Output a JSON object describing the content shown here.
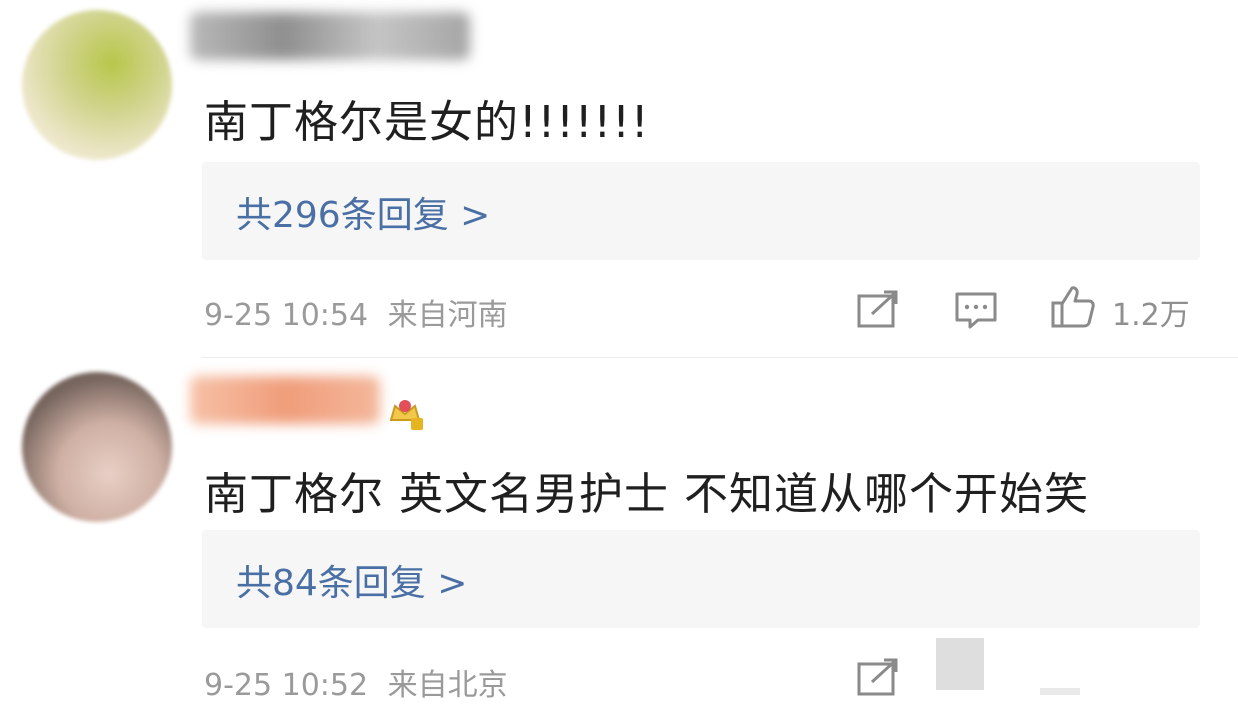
{
  "comments": [
    {
      "text": "南丁格尔是女的!!!!!!!",
      "reply_link": "共296条回复 >",
      "time": "9-25 10:54",
      "location": "来自河南",
      "likes": "1.2万",
      "avatar_colors": [
        "#c9cf7a",
        "#e9e4c6"
      ],
      "username_blur_color": "#9a9a9a"
    },
    {
      "text": "南丁格尔 英文名男护士 不知道从哪个开始笑",
      "reply_link": "共84条回复 >",
      "time": "9-25 10:52",
      "location": "来自北京",
      "avatar_colors": [
        "#6e5f58",
        "#d9bfb4"
      ],
      "username_blur_color": "#f0a487"
    }
  ],
  "colors": {
    "link": "#4a6fa5",
    "meta": "#9a9a9a",
    "reply_bg": "#f6f6f6"
  },
  "icons": [
    "share-icon",
    "comment-icon",
    "like-icon",
    "level-badge-icon"
  ]
}
